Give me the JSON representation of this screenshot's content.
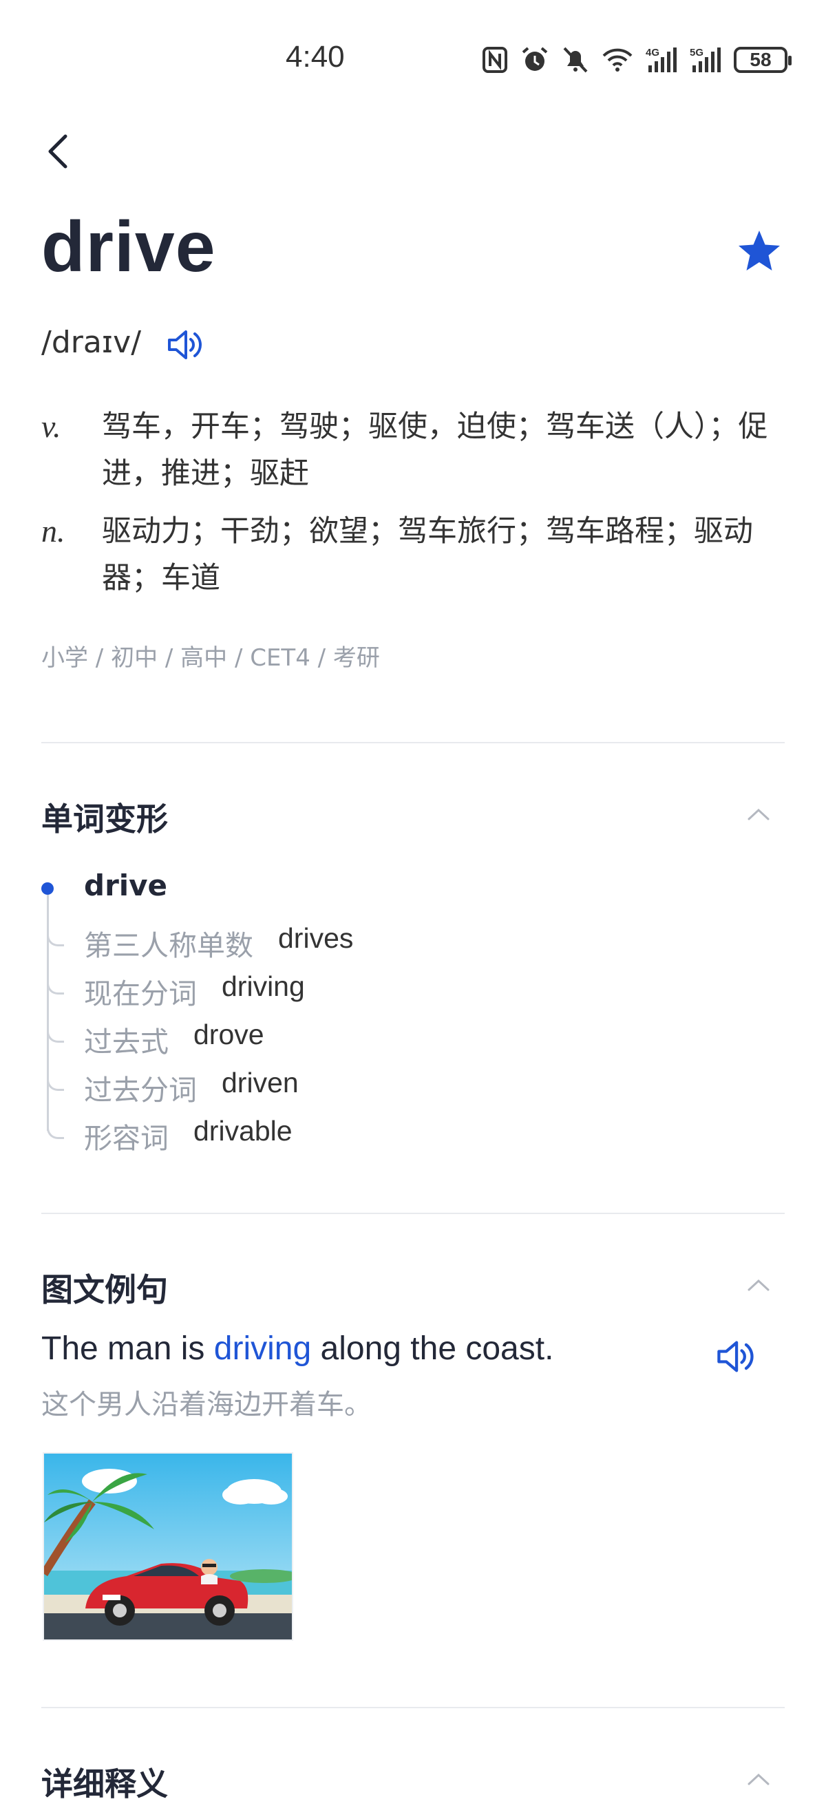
{
  "status_bar": {
    "time": "4:40",
    "battery": "58",
    "icons": [
      "nfc-icon",
      "alarm-icon",
      "mute-icon",
      "wifi-icon",
      "4g-signal-icon",
      "5g-signal-icon",
      "battery-icon"
    ]
  },
  "header": {
    "word": "drive",
    "phonetic": "/draɪv/",
    "favorited": true
  },
  "definitions": [
    {
      "pos": "v.",
      "text": "驾车，开车；驾驶；驱使，迫使；驾车送（人）；促进，推进；驱赶"
    },
    {
      "pos": "n.",
      "text": "驱动力；干劲；欲望；驾车旅行；驾车路程；驱动器；车道"
    }
  ],
  "levels": "小学 / 初中 / 高中 / CET4 / 考研",
  "word_forms": {
    "title": "单词变形",
    "base": "drive",
    "items": [
      {
        "label": "第三人称单数",
        "value": "drives"
      },
      {
        "label": "现在分词",
        "value": "driving"
      },
      {
        "label": "过去式",
        "value": "drove"
      },
      {
        "label": "过去分词",
        "value": "driven"
      },
      {
        "label": "形容词",
        "value": "drivable"
      }
    ]
  },
  "examples": {
    "title": "图文例句",
    "sentence_before": "The man is ",
    "sentence_highlight": "driving",
    "sentence_after": " along the coast.",
    "translation": "这个男人沿着海边开着车。"
  },
  "details": {
    "title": "详细释义"
  },
  "colors": {
    "accent": "#1f55d6",
    "muted": "#9aa0aa",
    "text": "#232838"
  }
}
